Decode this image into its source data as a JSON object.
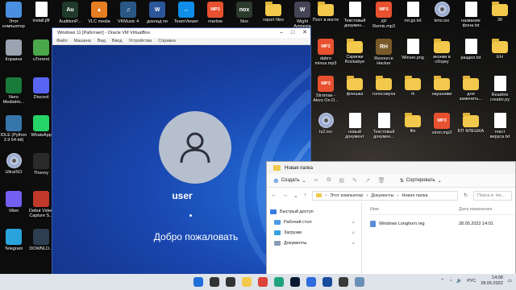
{
  "desktop_icons_left": [
    {
      "label": "Этот компьютер",
      "kind": "pc",
      "color": "#4a8fe0"
    },
    {
      "label": "Корзина",
      "kind": "bin",
      "color": "#9aa3b0"
    },
    {
      "label": "Nero MediaHo...",
      "kind": "app",
      "color": "#1a7a3a"
    },
    {
      "label": "IDLE (Python 3.9 64-bit)",
      "kind": "app",
      "color": "#3776ab"
    },
    {
      "label": "UltraISO",
      "kind": "disc",
      "color": "#8fa2c9"
    },
    {
      "label": "Viber",
      "kind": "app",
      "color": "#7360f2"
    },
    {
      "label": "Telegram",
      "kind": "app",
      "color": "#2aa3dd"
    }
  ],
  "desktop_icons_col2": [
    {
      "label": "install.jfif",
      "kind": "doc",
      "color": "#ffffff"
    },
    {
      "label": "uTorrent",
      "kind": "app",
      "color": "#4aa84a"
    },
    {
      "label": "Discord",
      "kind": "app",
      "color": "#5865f2"
    },
    {
      "label": "WhatsApp",
      "kind": "app",
      "color": "#25d366"
    },
    {
      "label": "Thonny",
      "kind": "app",
      "color": "#2a2a2a"
    },
    {
      "label": "Debut Video Capture S...",
      "kind": "app",
      "color": "#c0392b"
    },
    {
      "label": "DOWNLO...",
      "kind": "app",
      "color": "#2c3e50"
    }
  ],
  "desktop_icons_top": [
    {
      "label": "AuditionP...",
      "kind": "app",
      "color": "#1f3a2a",
      "glyph": "Au"
    },
    {
      "label": "VLC media",
      "kind": "app",
      "color": "#e67e22",
      "glyph": "▲"
    },
    {
      "label": "VKMusic 4",
      "kind": "app",
      "color": "#2a5885",
      "glyph": "♫"
    },
    {
      "label": "доклад по",
      "kind": "app",
      "color": "#2b579a",
      "glyph": "W"
    },
    {
      "label": "TeamViewer",
      "kind": "app",
      "color": "#0e8ee9",
      "glyph": "↔"
    },
    {
      "label": "marlow",
      "kind": "mp3",
      "color": "#e8512f",
      "glyph": "MP3"
    },
    {
      "label": "Nox",
      "kind": "app",
      "color": "#2b3a2b",
      "glyph": "nox"
    },
    {
      "label": "report files",
      "kind": "folder",
      "color": "#f2c94c",
      "glyph": ""
    },
    {
      "label": "Wight Amnesia",
      "kind": "app",
      "color": "#445",
      "glyph": "W"
    }
  ],
  "desktop_icons_right": [
    {
      "label": "Пост в инсте",
      "kind": "folder",
      "color": "#f2c94c",
      "glyph": ""
    },
    {
      "label": "Текстовый докумен...",
      "kind": "doc",
      "color": "#ffffff",
      "glyph": ""
    },
    {
      "label": "XP Remix.mp3",
      "kind": "mp3",
      "color": "#e8512f",
      "glyph": "MP3"
    },
    {
      "label": "rot.gs.txt",
      "kind": "doc",
      "color": "#ffffff",
      "glyph": ""
    },
    {
      "label": "kms.iso",
      "kind": "disc",
      "color": "#8fa2c9",
      "glyph": ""
    },
    {
      "label": "название фона.txt",
      "kind": "doc",
      "color": "#ffffff",
      "glyph": ""
    },
    {
      "label": "30",
      "kind": "folder",
      "color": "#f2c94c",
      "glyph": ""
    },
    {
      "label": "dabro minus.mp3",
      "kind": "mp3",
      "color": "#e8512f",
      "glyph": "MP3"
    },
    {
      "label": "Скрипки Rockabye",
      "kind": "folder",
      "color": "#f2c94c",
      "glyph": ""
    },
    {
      "label": "Resource Hacker",
      "kind": "app",
      "color": "#7a5a2a",
      "glyph": "RH"
    },
    {
      "label": "Winver.png",
      "kind": "doc",
      "color": "#ffffff",
      "glyph": ""
    },
    {
      "label": "иконки в сборку",
      "kind": "folder",
      "color": "#f2c94c",
      "glyph": ""
    },
    {
      "label": "раздел.txt",
      "kind": "doc",
      "color": "#ffffff",
      "glyph": ""
    },
    {
      "label": "EH",
      "kind": "folder",
      "color": "#f2c94c",
      "glyph": ""
    },
    {
      "label": "Stromae - Alors On D...",
      "kind": "mp3",
      "color": "#e8512f",
      "glyph": "MP3"
    },
    {
      "label": "флешка",
      "kind": "folder",
      "color": "#f2c94c",
      "glyph": ""
    },
    {
      "label": "голосовуха",
      "kind": "folder",
      "color": "#f2c94c",
      "glyph": ""
    },
    {
      "label": "rh",
      "kind": "folder",
      "color": "#f2c94c",
      "glyph": ""
    },
    {
      "label": "наушники",
      "kind": "folder",
      "color": "#f2c94c",
      "glyph": ""
    },
    {
      "label": "для заменить...",
      "kind": "folder",
      "color": "#f2c94c",
      "glyph": ""
    },
    {
      "label": "Readme creator.py",
      "kind": "doc",
      "color": "#ffffff",
      "glyph": ""
    },
    {
      "label": "ts2.iso",
      "kind": "disc",
      "color": "#8fa2c9",
      "glyph": ""
    },
    {
      "label": "новый документ",
      "kind": "doc",
      "color": "#ffffff",
      "glyph": ""
    },
    {
      "label": "Текстовый докумен...",
      "kind": "doc",
      "color": "#ffffff",
      "glyph": ""
    },
    {
      "label": "file",
      "kind": "folder",
      "color": "#f2c94c",
      "glyph": ""
    },
    {
      "label": "siren.mp3",
      "kind": "mp3",
      "color": "#e8512f",
      "glyph": "MP3"
    },
    {
      "label": "БП ФЛЕШКА",
      "kind": "folder",
      "color": "#f2c94c",
      "glyph": ""
    },
    {
      "label": "текст вируса.txt",
      "kind": "doc",
      "color": "#ffffff",
      "glyph": ""
    }
  ],
  "vbox": {
    "title": "Windows 11 [Работает] - Oracle VM VirtualBox",
    "menu": [
      "Файл",
      "Машина",
      "Вид",
      "Ввод",
      "Устройства",
      "Справка"
    ],
    "username": "user",
    "welcome": "Добро пожаловать"
  },
  "explorer": {
    "title": "Новая папка",
    "create_label": "Создать",
    "sort_label": "Сортировать",
    "breadcrumb": [
      "Этот компьютер",
      "Документы",
      "Новая папка"
    ],
    "search_placeholder": "Поиск в: Но...",
    "column_name": "Имя",
    "column_date": "Дата изменения",
    "sidebar": [
      {
        "label": "Быстрый доступ",
        "color": "#3d7be0",
        "pin": ""
      },
      {
        "label": "Рабочий стол",
        "color": "#4a9ae8",
        "pin": "⊿"
      },
      {
        "label": "Загрузки",
        "color": "#3aa0e0",
        "pin": "⊿"
      },
      {
        "label": "Документы",
        "color": "#8a9cb5",
        "pin": "⊿"
      }
    ],
    "files": [
      {
        "name": "Windows Longhorn.reg",
        "date": "28.05.2022 14:01"
      }
    ]
  },
  "taskbar": {
    "lang": "РУС",
    "time": "14:08",
    "date": "28.05.2022",
    "apps": [
      {
        "name": "start-icon",
        "color": "#1e6fd9"
      },
      {
        "name": "search-icon",
        "color": "#333333"
      },
      {
        "name": "task-view-icon",
        "color": "#333333"
      },
      {
        "name": "explorer-icon",
        "color": "#f2c94c"
      },
      {
        "name": "chrome-icon",
        "color": "#db4437"
      },
      {
        "name": "edge-icon",
        "color": "#1fa37a"
      },
      {
        "name": "photoshop-icon",
        "color": "#0a1a33"
      },
      {
        "name": "store-icon",
        "color": "#2d6cdf"
      },
      {
        "name": "virtualbox-icon",
        "color": "#1a4c9e"
      },
      {
        "name": "terminal-icon",
        "color": "#3a3a3a"
      },
      {
        "name": "notepad-icon",
        "color": "#6a8fb5"
      }
    ]
  }
}
